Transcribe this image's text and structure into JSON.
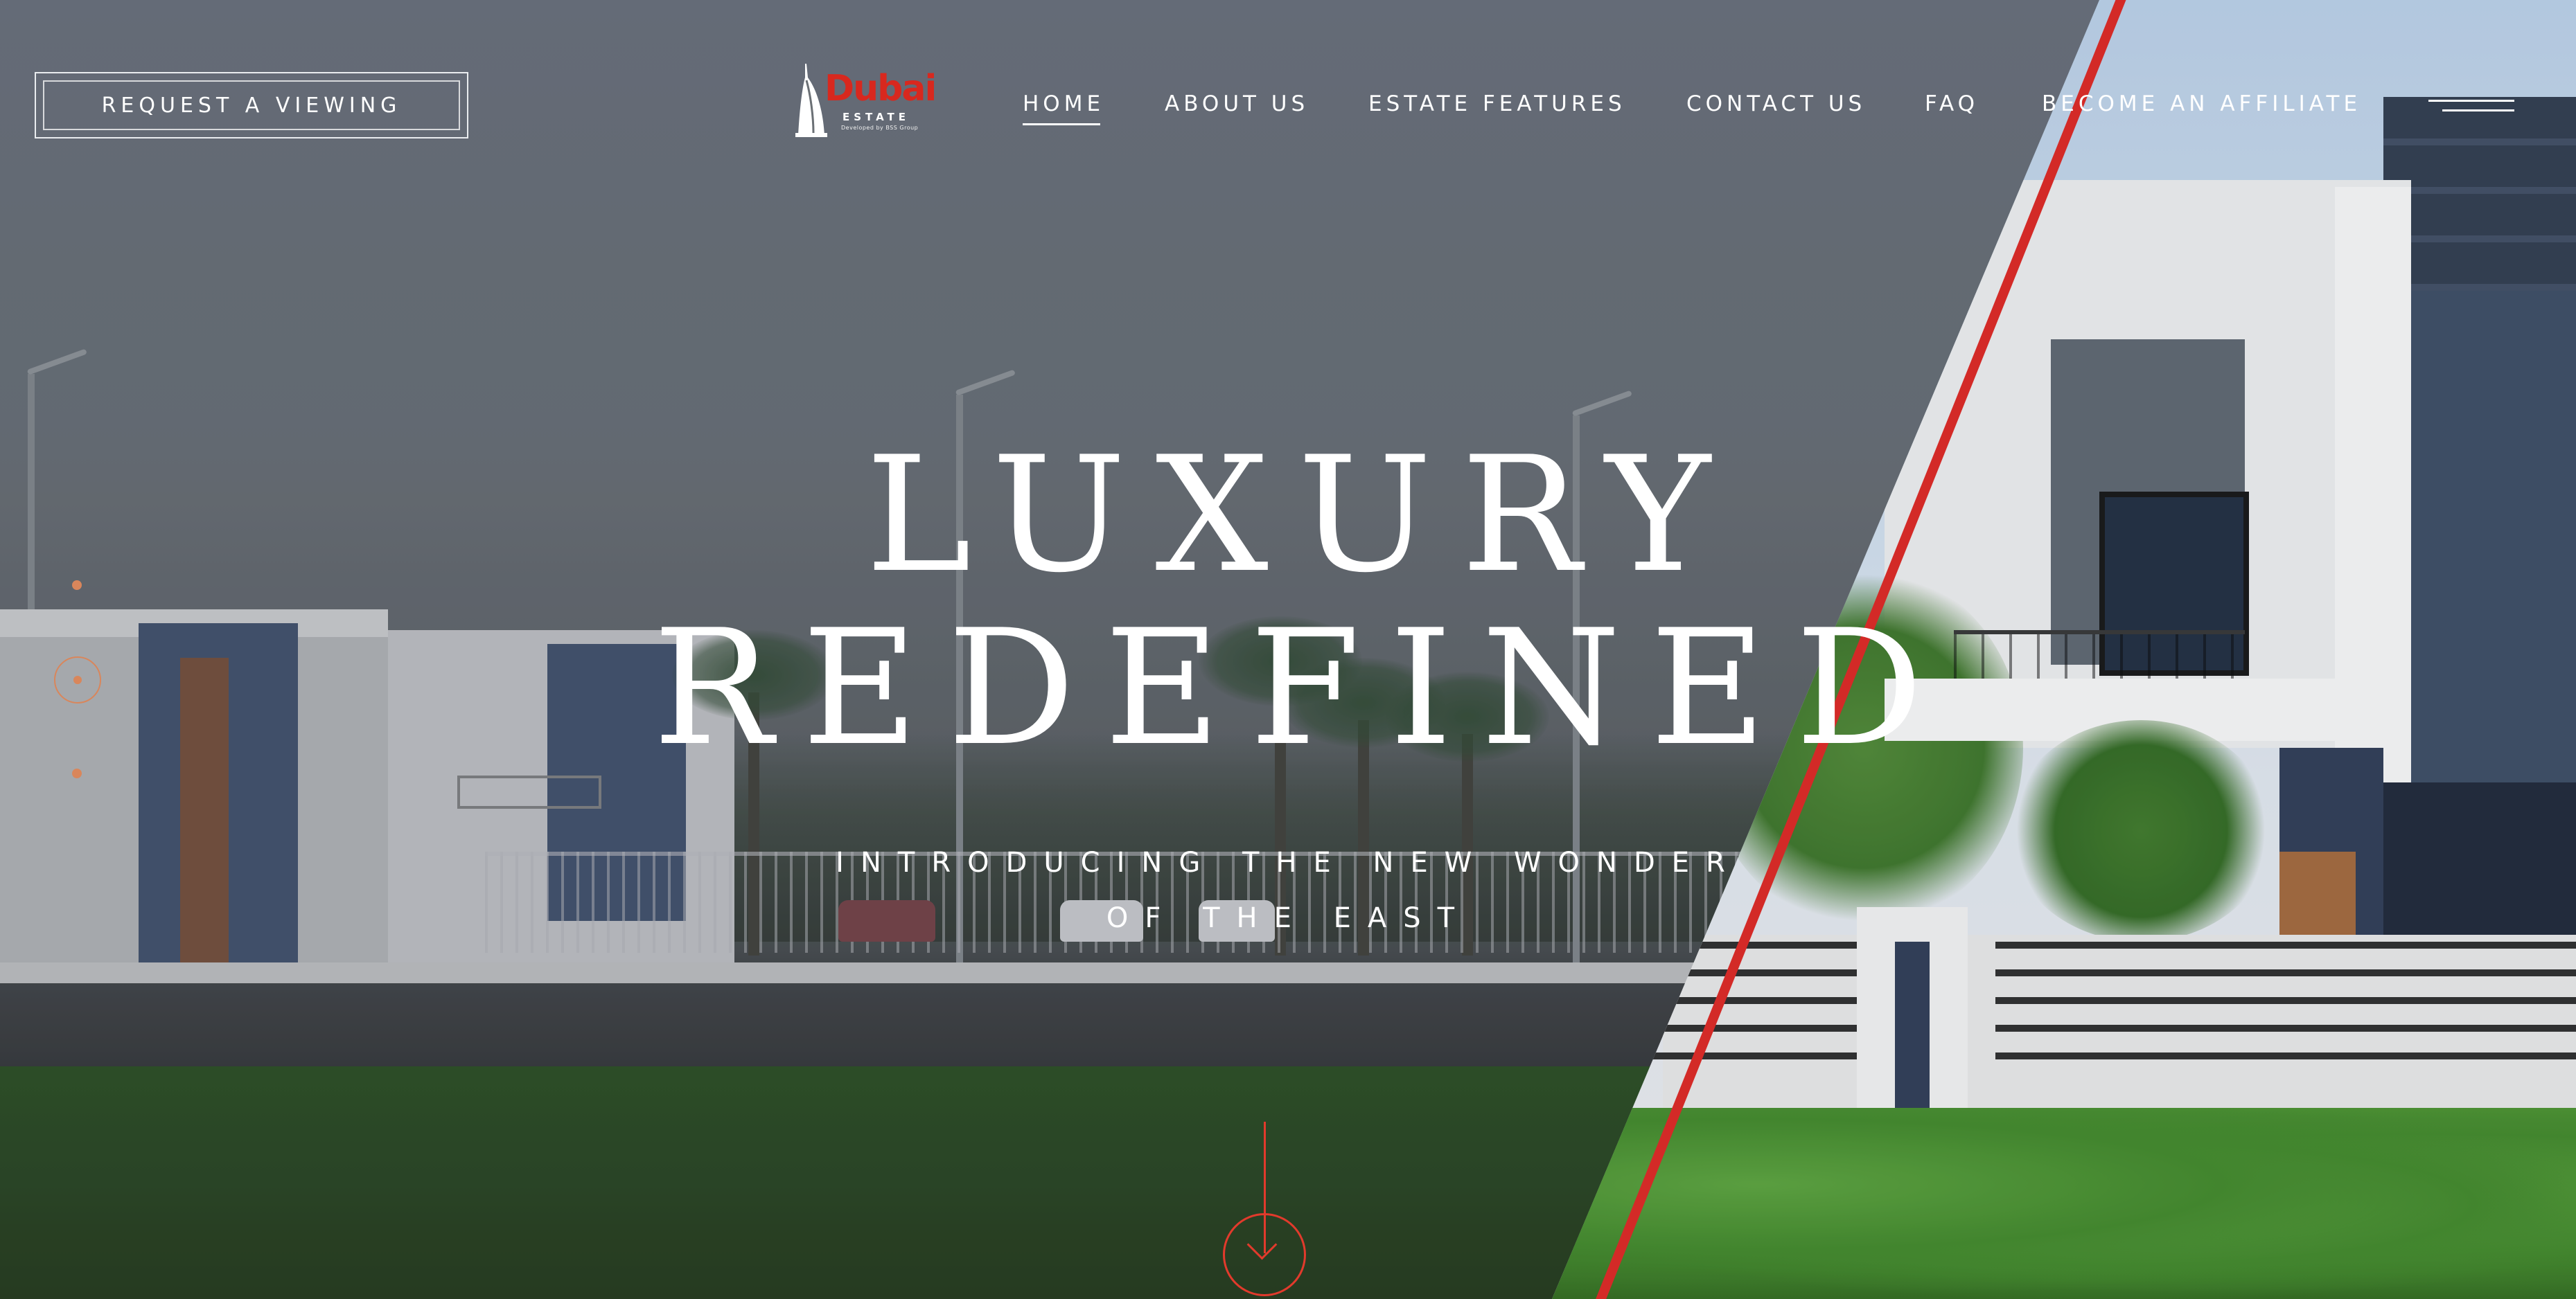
{
  "header": {
    "request_button": "REQUEST A VIEWING",
    "logo": {
      "word": "Dubai",
      "sub": "ESTATE",
      "tagline": "Developed by BSS Group"
    },
    "nav": [
      {
        "label": "HOME",
        "active": true
      },
      {
        "label": "ABOUT US",
        "active": false
      },
      {
        "label": "ESTATE FEATURES",
        "active": false
      },
      {
        "label": "CONTACT US",
        "active": false
      },
      {
        "label": "FAQ",
        "active": false
      },
      {
        "label": "BECOME AN AFFILIATE",
        "active": false
      }
    ],
    "menu_icon": "hamburger-icon"
  },
  "hero": {
    "headline_line1": "LUXURY",
    "headline_line2": "REDEFINED",
    "sub_line1": "INTRODUCING THE NEW WONDER",
    "sub_line2": "OF THE EAST",
    "scroll_icon": "arrow-down-circle-icon"
  },
  "colors": {
    "accent_red": "#e4231e",
    "logo_red": "#d8281e",
    "text": "#ffffff",
    "dot_orange": "#d9865b"
  }
}
